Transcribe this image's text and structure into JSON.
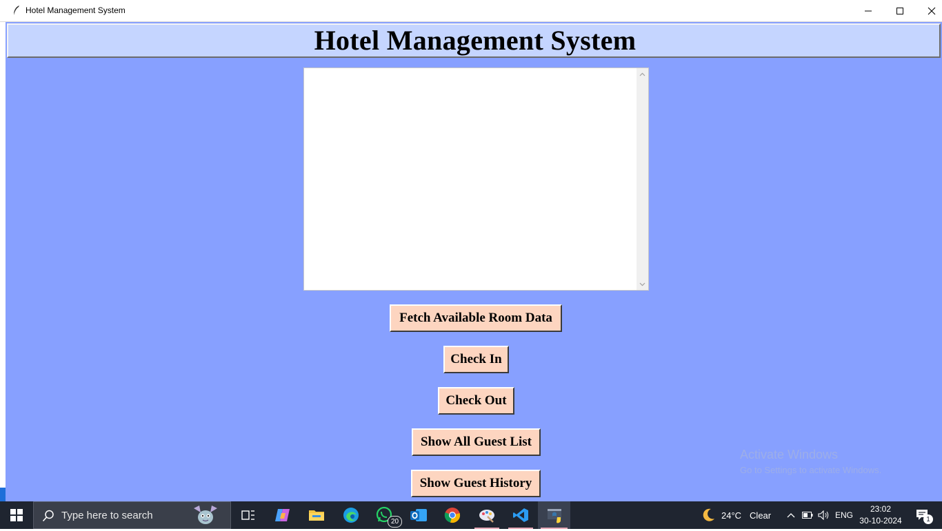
{
  "window": {
    "title": "Hotel Management System"
  },
  "header": {
    "title": "Hotel Management System"
  },
  "output_box": {
    "content": ""
  },
  "buttons": {
    "fetch": "Fetch Available Room Data",
    "check_in": "Check In",
    "check_out": "Check Out",
    "show_all": "Show All Guest List",
    "history": "Show Guest History"
  },
  "watermark": {
    "line1": "Activate Windows",
    "line2": "Go to Settings to activate Windows."
  },
  "taskbar": {
    "search_placeholder": "Type here to search",
    "whatsapp_badge": "20",
    "weather_temp": "24°C",
    "weather_desc": "Clear",
    "language": "ENG",
    "time": "23:02",
    "date": "30-10-2024",
    "notification_count": "1"
  },
  "colors": {
    "client_bg": "#87a0ff",
    "header_bg": "#c5d5ff",
    "button_bg": "#fdd5c0",
    "taskbar_bg": "#1f2530"
  }
}
